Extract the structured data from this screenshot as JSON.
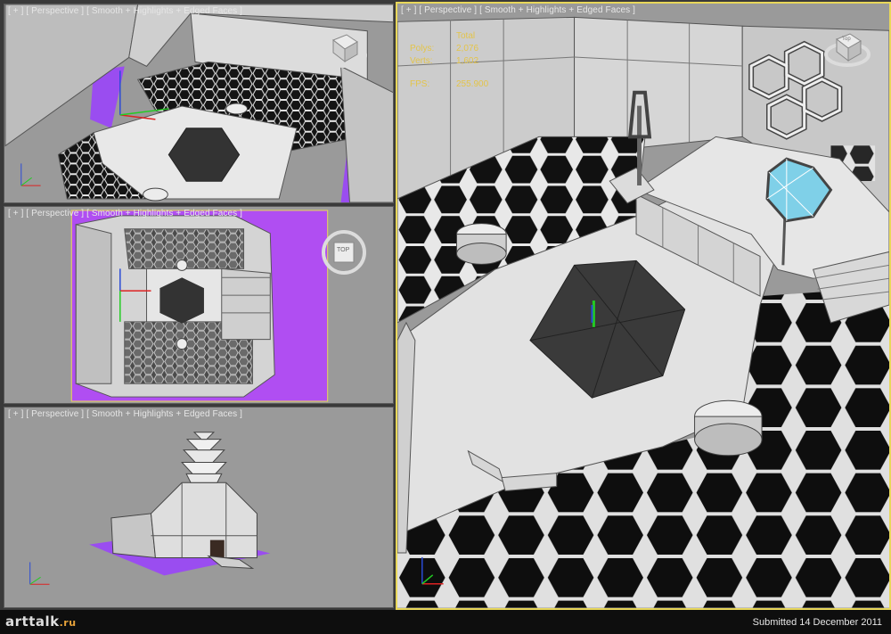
{
  "viewports": {
    "top_left": {
      "label": "[ + ] [ Perspective ] [ Smooth + Highlights + Edged Faces ]"
    },
    "mid_left": {
      "label": "[ + ] [ Perspective ] [ Smooth + Highlights + Edged Faces ]"
    },
    "bottom_left": {
      "label": "[ + ] [ Perspective ] [ Smooth + Highlights + Edged Faces ]"
    },
    "main": {
      "label": "[ + ] [ Perspective ] [ Smooth + Highlights + Edged Faces ]",
      "stats": [
        {
          "key": "",
          "value": "Total"
        },
        {
          "key": "Polys:",
          "value": "2,076"
        },
        {
          "key": "Verts:",
          "value": "1,602"
        },
        {
          "key": "FPS:",
          "value": "255.900"
        }
      ]
    }
  },
  "viewcube": {
    "top_label": "TOP",
    "face_label": "Top"
  },
  "footer": {
    "logo_text": "arttalk",
    "logo_suffix": ".ru",
    "submitted": "Submitted 14 December 2011"
  },
  "colors": {
    "viewport_bg": "#9a9a9a",
    "active_border": "#e8d75a",
    "floor_dark": "#2e2e2e",
    "floor_light": "#e6e6e6",
    "purple": "#9a4df0",
    "glass": "#7fd0e8"
  }
}
